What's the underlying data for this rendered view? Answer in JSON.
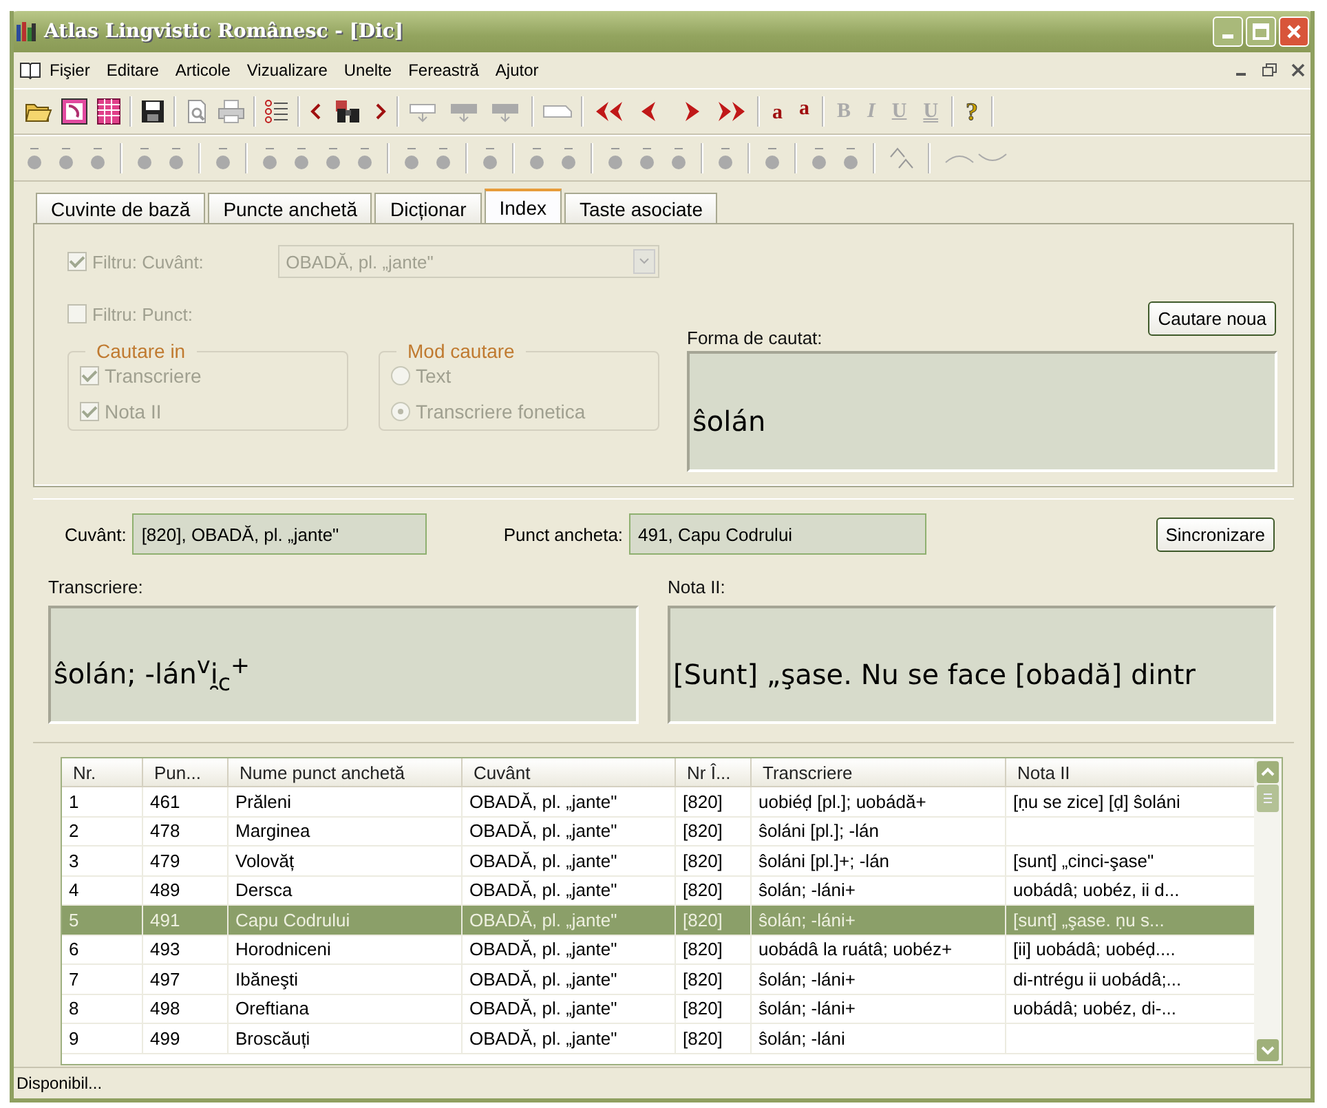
{
  "window": {
    "title": "Atlas Lingvistic Românesc - [Dic]"
  },
  "menu": [
    "Fişier",
    "Editare",
    "Articole",
    "Vizualizare",
    "Unelte",
    "Fereastră",
    "Ajutor"
  ],
  "toolbar_text_buttons": [
    {
      "text": "a",
      "kind": "raise",
      "disabled": false
    },
    {
      "text": "a",
      "kind": "lower",
      "disabled": false
    },
    {
      "text": "B",
      "kind": "bold",
      "disabled": true
    },
    {
      "text": "I",
      "kind": "italic",
      "disabled": true
    },
    {
      "text": "U",
      "kind": "underline",
      "disabled": true
    },
    {
      "text": "U",
      "kind": "double-underline",
      "disabled": true
    },
    {
      "text": "?",
      "kind": "help",
      "disabled": false
    }
  ],
  "tabs": [
    {
      "label": "Cuvinte de bază",
      "selected": false
    },
    {
      "label": "Puncte anchetă",
      "selected": false
    },
    {
      "label": "Dicționar",
      "selected": false
    },
    {
      "label": "Index",
      "selected": true
    },
    {
      "label": "Taste asociate",
      "selected": false
    }
  ],
  "filters": {
    "disabled": true,
    "word_filter": {
      "label": "Filtru: Cuvânt:",
      "checked": true,
      "value": "OBADĂ, pl. „jante\""
    },
    "point_filter": {
      "label": "Filtru: Punct:",
      "checked": false
    },
    "search_in": {
      "title": "Cautare in",
      "options": [
        {
          "label": "Transcriere",
          "checked": true
        },
        {
          "label": "Nota II",
          "checked": true
        }
      ]
    },
    "search_mode": {
      "title": "Mod cautare",
      "options": [
        {
          "label": "Text",
          "selected": false
        },
        {
          "label": "Transcriere fonetica",
          "selected": true
        }
      ]
    }
  },
  "search_form": {
    "label": "Forma de cautat:",
    "value": "ŝolán",
    "button": "Cautare noua"
  },
  "details": {
    "word_label": "Cuvânt:",
    "word": "[820], OBADĂ, pl. „jante\"",
    "point_label": "Punct ancheta:",
    "point": "491, Capu Codrului",
    "sync_button": "Sincronizare",
    "transcription_label": "Transcriere:",
    "transcription": "ŝolán; -lán$^{v}$i̯$_{c}$$^{+}$",
    "note_label": "Nota II:",
    "note": "[Sunt] „şase. Nu se face [obadă] dintr"
  },
  "table": {
    "columns": [
      "Nr.",
      "Pun...",
      "Nume punct anchetă",
      "Cuvânt",
      "Nr Î...",
      "Transcriere",
      "Nota II"
    ],
    "rows": [
      {
        "selected": false,
        "cells": [
          "1",
          "461",
          "Prăleni",
          "OBADĂ, pl. „jante\"",
          "[820]",
          "uobiéḍ [pl.]; uobádă+",
          "[ṇu se zice] [ḍ] ŝoláni"
        ]
      },
      {
        "selected": false,
        "cells": [
          "2",
          "478",
          "Marginea",
          "OBADĂ, pl. „jante\"",
          "[820]",
          "ŝoláni [pl.]; -lán",
          ""
        ]
      },
      {
        "selected": false,
        "cells": [
          "3",
          "479",
          "Volovăț",
          "OBADĂ, pl. „jante\"",
          "[820]",
          "ŝoláni [pl.]+; -lán",
          "[sunt] „cinci-şase\""
        ]
      },
      {
        "selected": false,
        "cells": [
          "4",
          "489",
          "Dersca",
          "OBADĂ, pl. „jante\"",
          "[820]",
          "ŝolán; -láni+",
          "uobádâ; uobéz, ii d..."
        ]
      },
      {
        "selected": true,
        "cells": [
          "5",
          "491",
          "Capu Codrului",
          "OBADĂ, pl. „jante\"",
          "[820]",
          "ŝolán; -láni+",
          "[sunt] „şase. ṇu s..."
        ]
      },
      {
        "selected": false,
        "cells": [
          "6",
          "493",
          "Horodniceni",
          "OBADĂ, pl. „jante\"",
          "[820]",
          "uobádâ la ruátâ; uobéz+",
          "[ii] uobádâ; uobéḍ...."
        ]
      },
      {
        "selected": false,
        "cells": [
          "7",
          "497",
          "Ibăneşti",
          "OBADĂ, pl. „jante\"",
          "[820]",
          "ŝolán; -láni+",
          "di-ntrégu ii uobádâ;..."
        ]
      },
      {
        "selected": false,
        "cells": [
          "8",
          "498",
          "Oreftiana",
          "OBADĂ, pl. „jante\"",
          "[820]",
          "ŝolán; -láni+",
          "uobádâ; uobéz, di-..."
        ]
      },
      {
        "selected": false,
        "cells": [
          "9",
          "499",
          "Broscăuți",
          "OBADĂ, pl. „jante\"",
          "[820]",
          "ŝolán; -láni",
          ""
        ]
      }
    ]
  },
  "status_bar": "Disponibil..."
}
